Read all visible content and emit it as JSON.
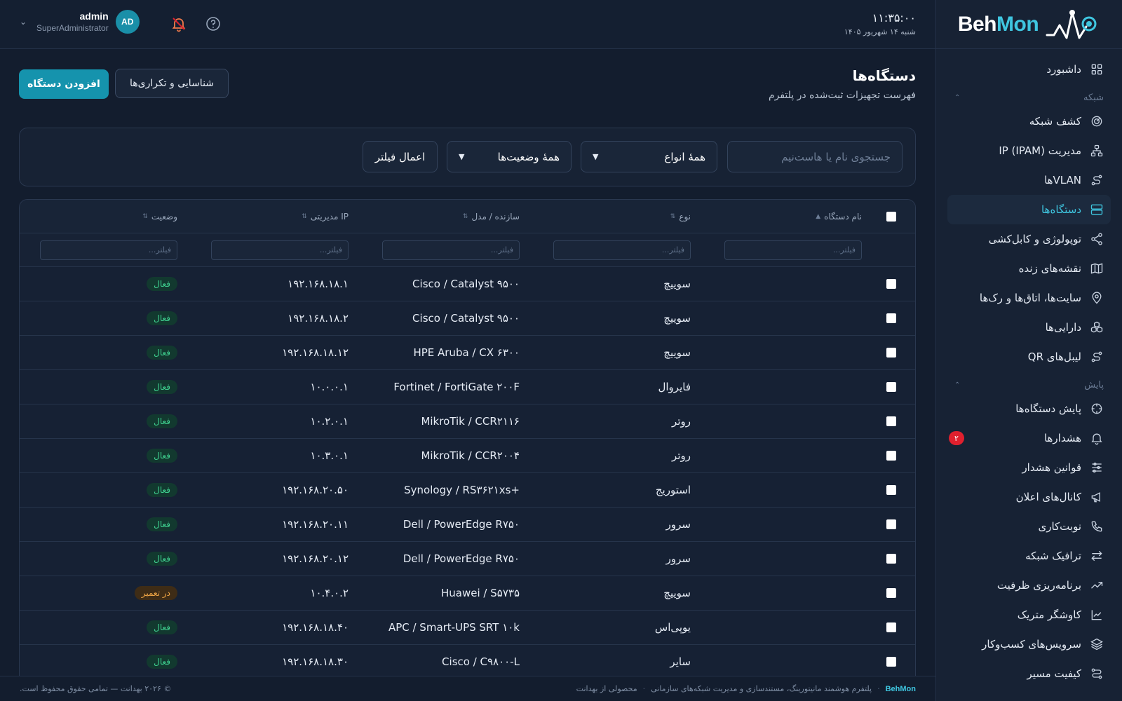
{
  "brand": {
    "part1": "Beh",
    "part2": "Mon"
  },
  "header": {
    "time": "۱۱:۳۵:۰۰",
    "date": "شنبه ۱۴ شهریور ۱۴۰۵",
    "user_name": "admin",
    "user_role": "SuperAdministrator",
    "avatar_initials": "AD"
  },
  "sidebar": {
    "dashboard": "داشبورد",
    "section_network": "شبکه",
    "network_items": [
      {
        "label": "کشف شبکه",
        "icon": "radar-icon"
      },
      {
        "label": "مدیریت IP (IPAM)",
        "icon": "network-tree-icon"
      },
      {
        "label": "VLANها",
        "icon": "route-icon"
      },
      {
        "label": "دستگاه‌ها",
        "icon": "server-icon",
        "active": true
      },
      {
        "label": "توپولوژی و کابل‌کشی",
        "icon": "share-icon"
      },
      {
        "label": "نقشه‌های زنده",
        "icon": "map-icon"
      },
      {
        "label": "سایت‌ها، اتاق‌ها و رک‌ها",
        "icon": "map-pin-icon"
      },
      {
        "label": "دارایی‌ها",
        "icon": "boxes-icon"
      },
      {
        "label": "لیبل‌های QR",
        "icon": "route-icon"
      }
    ],
    "section_monitoring": "پایش",
    "monitoring_items": [
      {
        "label": "پایش دستگاه‌ها",
        "icon": "crosshair-icon"
      },
      {
        "label": "هشدارها",
        "icon": "bell-icon",
        "badge": "۲"
      },
      {
        "label": "قوانین هشدار",
        "icon": "sliders-icon"
      },
      {
        "label": "کانال‌های اعلان",
        "icon": "megaphone-icon"
      },
      {
        "label": "نوبت‌کاری",
        "icon": "phone-icon"
      },
      {
        "label": "ترافیک شبکه",
        "icon": "arrows-icon"
      },
      {
        "label": "برنامه‌ریزی ظرفیت",
        "icon": "trend-icon"
      },
      {
        "label": "کاوشگر متریک",
        "icon": "chart-line-icon"
      },
      {
        "label": "سرویس‌های کسب‌وکار",
        "icon": "layers-icon"
      },
      {
        "label": "کیفیت مسیر",
        "icon": "path-icon"
      }
    ]
  },
  "page": {
    "title": "دستگاه‌ها",
    "subtitle": "فهرست تجهیزات ثبت‌شده در پلتفرم",
    "add_button": "افزودن دستگاه",
    "discovery_button": "شناسایی و تکراری‌ها"
  },
  "filters": {
    "search_placeholder": "جستجوی نام یا هاست‌نیم",
    "type_value": "همهٔ انواع",
    "status_value": "همهٔ وضعیت‌ها",
    "apply_label": "اعمال فیلتر"
  },
  "table": {
    "columns": {
      "name": "نام دستگاه",
      "type": "نوع",
      "vendor": "سازنده / مدل",
      "ip": "IP مدیریتی",
      "status": "وضعیت"
    },
    "filter_placeholder": "فیلتر...",
    "rows": [
      {
        "name": "",
        "type": "سوییچ",
        "vendor": "Cisco / Catalyst ۹۵۰۰",
        "ip": "۱۹۲.۱۶۸.۱۸.۱",
        "status": "فعال",
        "status_kind": "ok"
      },
      {
        "name": "",
        "type": "سوییچ",
        "vendor": "Cisco / Catalyst ۹۵۰۰",
        "ip": "۱۹۲.۱۶۸.۱۸.۲",
        "status": "فعال",
        "status_kind": "ok"
      },
      {
        "name": "",
        "type": "سوییچ",
        "vendor": "HPE Aruba / CX ۶۳۰۰",
        "ip": "۱۹۲.۱۶۸.۱۸.۱۲",
        "status": "فعال",
        "status_kind": "ok"
      },
      {
        "name": "",
        "type": "فایروال",
        "vendor": "Fortinet / FortiGate ۲۰۰F",
        "ip": "۱۰.۰.۰.۱",
        "status": "فعال",
        "status_kind": "ok"
      },
      {
        "name": "",
        "type": "روتر",
        "vendor": "MikroTik / CCR۲۱۱۶",
        "ip": "۱۰.۲.۰.۱",
        "status": "فعال",
        "status_kind": "ok"
      },
      {
        "name": "",
        "type": "روتر",
        "vendor": "MikroTik / CCR۲۰۰۴",
        "ip": "۱۰.۳.۰.۱",
        "status": "فعال",
        "status_kind": "ok"
      },
      {
        "name": "",
        "type": "استوریج",
        "vendor": "Synology / RS۳۶۲۱xs+",
        "ip": "۱۹۲.۱۶۸.۲۰.۵۰",
        "status": "فعال",
        "status_kind": "ok"
      },
      {
        "name": "",
        "type": "سرور",
        "vendor": "Dell / PowerEdge R۷۵۰",
        "ip": "۱۹۲.۱۶۸.۲۰.۱۱",
        "status": "فعال",
        "status_kind": "ok"
      },
      {
        "name": "",
        "type": "سرور",
        "vendor": "Dell / PowerEdge R۷۵۰",
        "ip": "۱۹۲.۱۶۸.۲۰.۱۲",
        "status": "فعال",
        "status_kind": "ok"
      },
      {
        "name": "",
        "type": "سوییچ",
        "vendor": "Huawei / S۵۷۳۵",
        "ip": "۱۰.۴.۰.۲",
        "status": "در تعمیر",
        "status_kind": "warn"
      },
      {
        "name": "",
        "type": "یوپی‌اس",
        "vendor": "APC / Smart-UPS SRT ۱۰k",
        "ip": "۱۹۲.۱۶۸.۱۸.۴۰",
        "status": "فعال",
        "status_kind": "ok"
      },
      {
        "name": "",
        "type": "سایر",
        "vendor": "Cisco / C۹۸۰۰-L",
        "ip": "۱۹۲.۱۶۸.۱۸.۳۰",
        "status": "فعال",
        "status_kind": "ok"
      }
    ]
  },
  "footer": {
    "brand": "BehMon",
    "tagline": "پلتفرم هوشمند مانیتورینگ، مستندسازی و مدیریت شبکه‌های سازمانی",
    "product_of": "محصولی از بهدانت",
    "copyright": "© ۲۰۲۶ بهدانت — تمامی حقوق محفوظ است."
  },
  "colors": {
    "accent": "#3fc6e0",
    "primary_button": "#1593ad",
    "ok": "#3fd08f",
    "warn": "#f0a646",
    "alert_badge": "#e0202e"
  }
}
